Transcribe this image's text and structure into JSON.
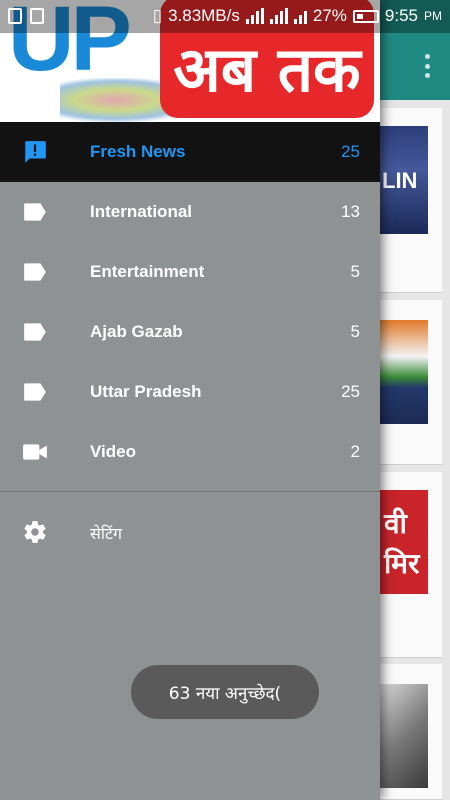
{
  "status_bar": {
    "speed": "3.83MB/s",
    "battery_percent": "27%",
    "time": "9:55",
    "ampm": "PM"
  },
  "drawer": {
    "logo_left": "UP",
    "logo_right": "अब तक",
    "items": [
      {
        "label": "Fresh News",
        "count": "25",
        "icon": "message-alert-icon",
        "active": true
      },
      {
        "label": "International",
        "count": "13",
        "icon": "label-tag-icon",
        "active": false
      },
      {
        "label": "Entertainment",
        "count": "5",
        "icon": "label-tag-icon",
        "active": false
      },
      {
        "label": "Ajab Gazab",
        "count": "5",
        "icon": "label-tag-icon",
        "active": false
      },
      {
        "label": "Uttar Pradesh",
        "count": "25",
        "icon": "label-tag-icon",
        "active": false
      },
      {
        "label": "Video",
        "count": "2",
        "icon": "video-camera-icon",
        "active": false
      }
    ],
    "settings_label": "सेटिंग",
    "settings_icon": "gear-icon"
  },
  "background": {
    "card1_text": "LIN",
    "card3_text": "वी मिर"
  },
  "toast": {
    "message": "63 नया अनुच्छेद("
  },
  "colors": {
    "accent": "#2196f3",
    "toolbar": "#1f8a82",
    "drawer_bg": "#8e9293",
    "active_bg": "#121212"
  }
}
